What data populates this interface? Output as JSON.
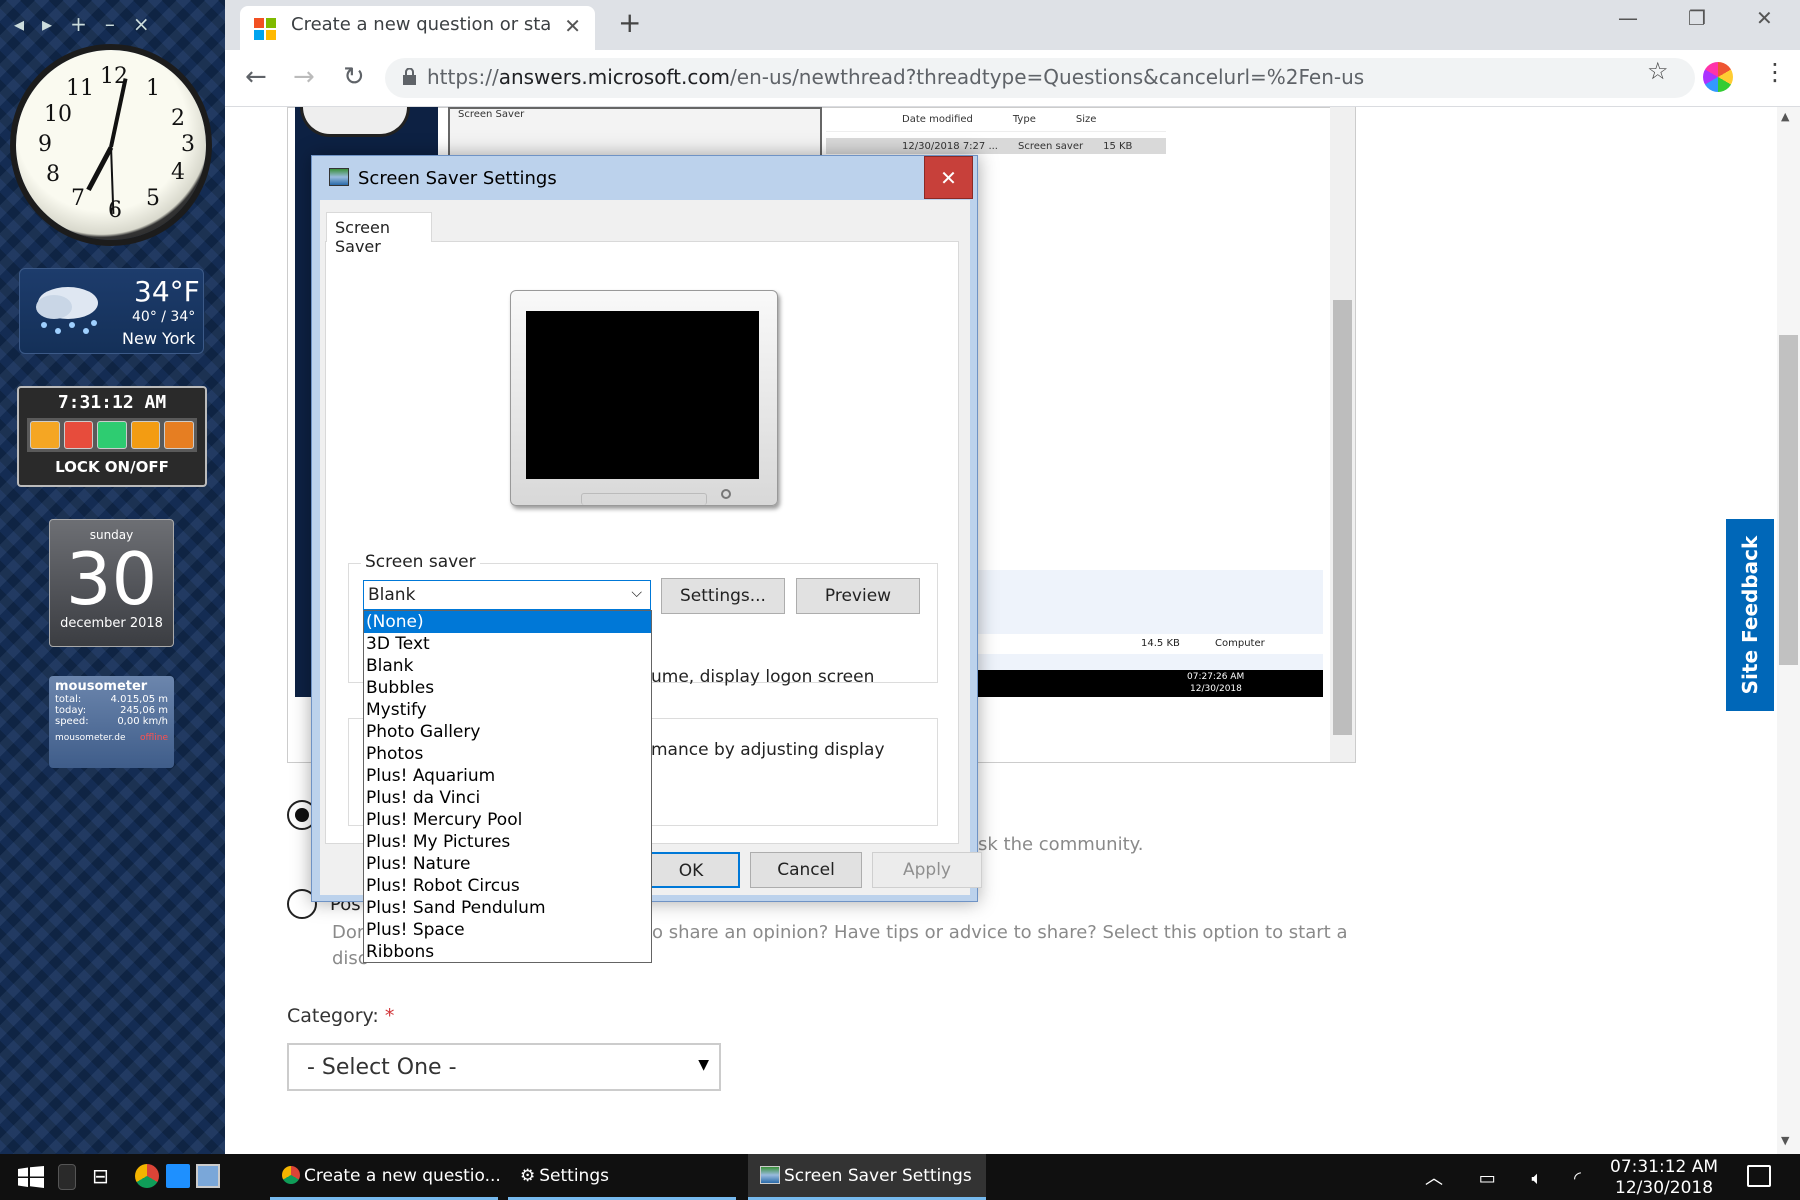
{
  "desktop": {
    "sidebar_tools": [
      "◂",
      "▸",
      "+",
      "–",
      "×"
    ],
    "clock_numbers": [
      "12",
      "1",
      "2",
      "3",
      "4",
      "5",
      "6",
      "7",
      "8",
      "9",
      "10",
      "11"
    ],
    "weather": {
      "temp": "34°F",
      "range": "40° / 34°",
      "city": "New York"
    },
    "lock": {
      "time": "7:31:12 AM",
      "label": "LOCK ON/OFF"
    },
    "calendar": {
      "weekday": "sunday",
      "day": "30",
      "month": "december 2018"
    },
    "mousometer": {
      "title": "mousometer",
      "rows": [
        {
          "label": "total:",
          "value": "4.015,05 m"
        },
        {
          "label": "today:",
          "value": "245,06 m"
        },
        {
          "label": "speed:",
          "value": "0,00 km/h"
        }
      ],
      "footer": "mousometer.de",
      "status": "offline"
    }
  },
  "browser": {
    "tab_title": "Create a new question or start a",
    "url_prefix": "https://",
    "url_host": "answers.microsoft.com",
    "url_path": "/en-us/newthread?threadtype=Questions&cancelurl=%2Fen-us"
  },
  "page": {
    "bg_window_title": "Screen Saver",
    "explorer": {
      "headers": [
        "Date modified",
        "Type",
        "Size"
      ],
      "row": [
        "12/30/2018 7:27 ...",
        "Screen saver",
        "15 KB"
      ]
    },
    "bg_status": {
      "size": "14.5 KB",
      "location": "Computer",
      "time": "07:27:26 AM",
      "date": "12/30/2018"
    },
    "option1_desc": "sk the community.",
    "option2_label": "Pos",
    "option2_desc_left": "Dor",
    "option2_desc": "o share an opinion? Have tips or advice to share? Select this option to start a",
    "option2_desc2": "disc",
    "category_label": "Category:",
    "category_required": "*",
    "category_value": "- Select One -",
    "site_feedback": "Site Feedback"
  },
  "dialog": {
    "title": "Screen Saver Settings",
    "tab": "Screen Saver",
    "group_label": "Screen saver",
    "selected": "Blank",
    "settings_button": "Settings...",
    "preview_button": "Preview",
    "logon_text": "ume, display logon screen",
    "power_text": "mance by adjusting display",
    "ok": "OK",
    "cancel": "Cancel",
    "apply": "Apply",
    "options": [
      "(None)",
      "3D Text",
      "Blank",
      "Bubbles",
      "Mystify",
      "Photo Gallery",
      "Photos",
      "Plus! Aquarium",
      "Plus! da Vinci",
      "Plus! Mercury Pool",
      "Plus! My Pictures",
      "Plus! Nature",
      "Plus! Robot Circus",
      "Plus! Sand Pendulum",
      "Plus! Space",
      "Ribbons"
    ],
    "highlighted_option": "(None)"
  },
  "taskbar": {
    "tasks": [
      "Create a new questio...",
      "Settings",
      "Screen Saver Settings"
    ],
    "time": "07:31:12 AM",
    "date": "12/30/2018"
  }
}
